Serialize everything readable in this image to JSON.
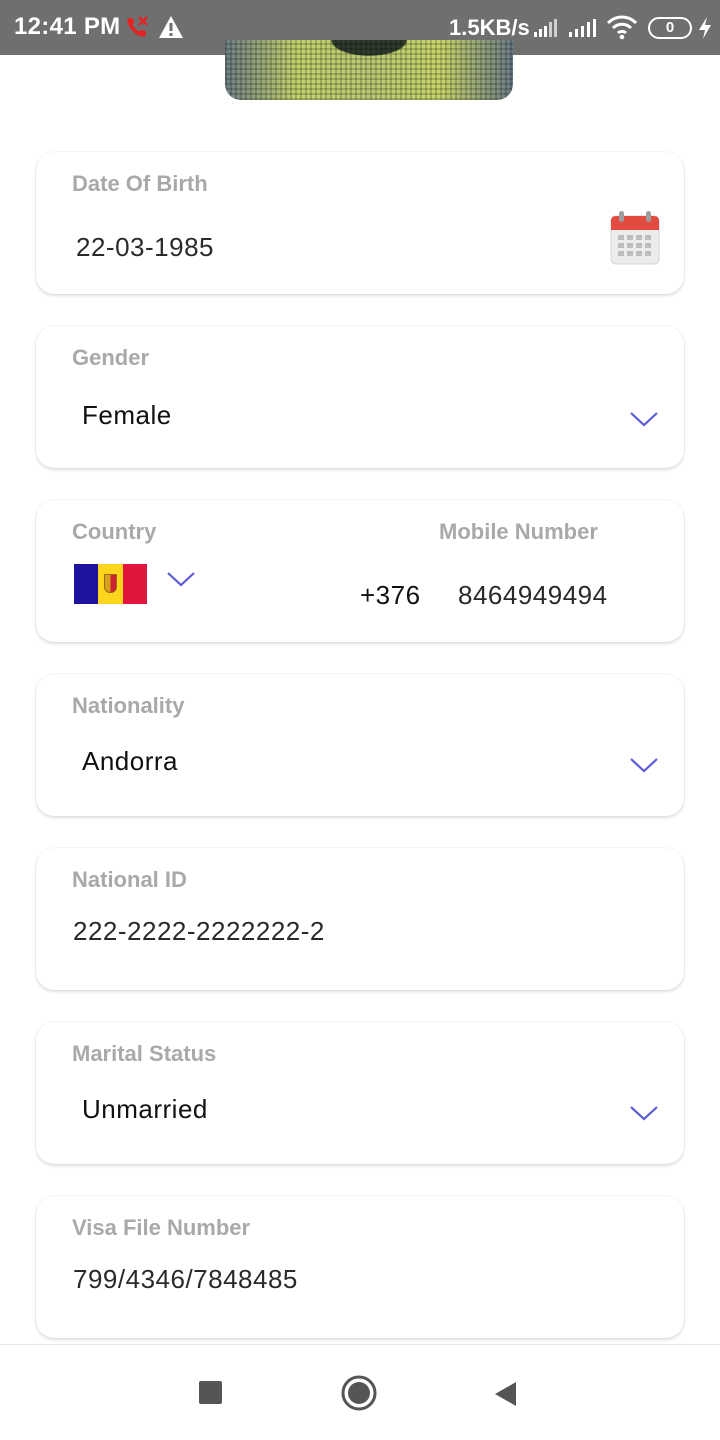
{
  "status_bar": {
    "time": "12:41 PM",
    "network_speed": "1.5KB/s",
    "battery_level": "0",
    "icons": [
      "missed-call-icon",
      "warning-icon",
      "signal-icon",
      "signal-icon",
      "wifi-icon",
      "battery-icon",
      "charging-icon"
    ]
  },
  "form": {
    "date_of_birth": {
      "label": "Date Of Birth",
      "value": "22-03-1985",
      "icon": "calendar-icon"
    },
    "gender": {
      "label": "Gender",
      "value": "Female"
    },
    "country": {
      "label": "Country",
      "flag": "andorra-flag"
    },
    "mobile_number": {
      "label": "Mobile Number",
      "dial_code": "+376",
      "value": "8464949494"
    },
    "nationality": {
      "label": "Nationality",
      "value": "Andorra"
    },
    "national_id": {
      "label": "National ID",
      "value": "222-2222-2222222-2"
    },
    "marital_status": {
      "label": "Marital Status",
      "value": "Unmarried"
    },
    "visa_file_number": {
      "label": "Visa File Number",
      "value": "799/4346/7848485"
    }
  },
  "nav_bar": {
    "icons": [
      "recents-icon",
      "home-icon",
      "back-icon"
    ]
  },
  "colors": {
    "status_bar_bg": "#6f6f6f",
    "label": "#a9a9a9",
    "accent_chevron": "#5b5bd6",
    "calendar_red": "#e24b3f"
  }
}
